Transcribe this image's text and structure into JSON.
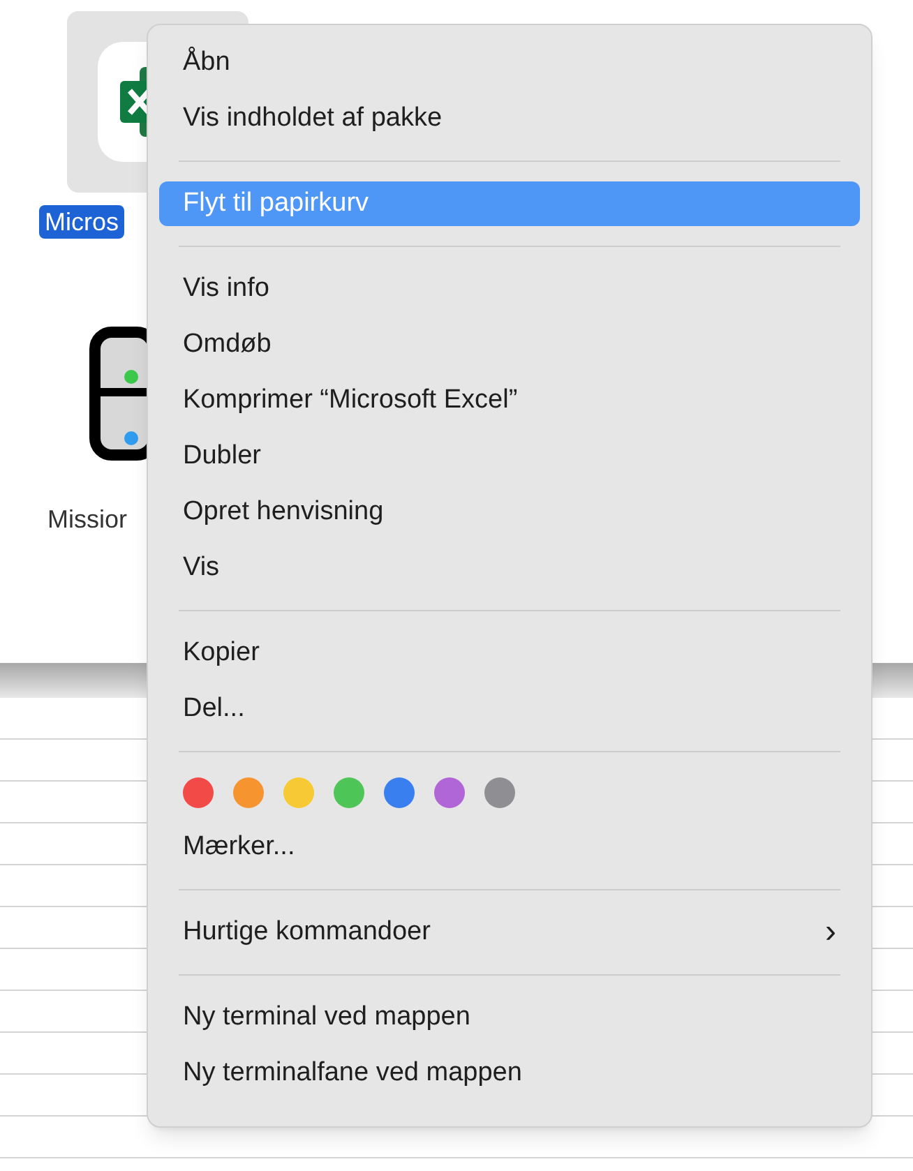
{
  "desktop_items": [
    {
      "kind": "excel",
      "label": "Micros",
      "selected": true
    },
    {
      "kind": "mission",
      "label": "Missior",
      "selected": false
    }
  ],
  "context_menu": {
    "sections": [
      [
        {
          "kind": "item",
          "label": "Åbn",
          "selected": false
        },
        {
          "kind": "item",
          "label": "Vis indholdet af pakke",
          "selected": false
        }
      ],
      [
        {
          "kind": "item",
          "label": "Flyt til papirkurv",
          "selected": true
        }
      ],
      [
        {
          "kind": "item",
          "label": "Vis info",
          "selected": false
        },
        {
          "kind": "item",
          "label": "Omdøb",
          "selected": false
        },
        {
          "kind": "item",
          "label": "Komprimer “Microsoft Excel”",
          "selected": false
        },
        {
          "kind": "item",
          "label": "Dubler",
          "selected": false
        },
        {
          "kind": "item",
          "label": "Opret henvisning",
          "selected": false
        },
        {
          "kind": "item",
          "label": "Vis",
          "selected": false
        }
      ],
      [
        {
          "kind": "item",
          "label": "Kopier",
          "selected": false
        },
        {
          "kind": "item",
          "label": "Del...",
          "selected": false
        }
      ],
      [
        {
          "kind": "tags",
          "tags": [
            {
              "color": "#f24b47"
            },
            {
              "color": "#f6952f"
            },
            {
              "color": "#f7c935"
            },
            {
              "color": "#4dc557"
            },
            {
              "color": "#3a7ff0"
            },
            {
              "color": "#b166d8"
            },
            {
              "color": "#8e8e93"
            }
          ]
        },
        {
          "kind": "item",
          "label": "Mærker...",
          "selected": false
        }
      ],
      [
        {
          "kind": "submenu",
          "label": "Hurtige kommandoer",
          "arrow": "›",
          "selected": false
        }
      ],
      [
        {
          "kind": "item",
          "label": "Ny terminal ved mappen",
          "selected": false
        },
        {
          "kind": "item",
          "label": "Ny terminalfane ved mappen",
          "selected": false
        }
      ]
    ]
  }
}
